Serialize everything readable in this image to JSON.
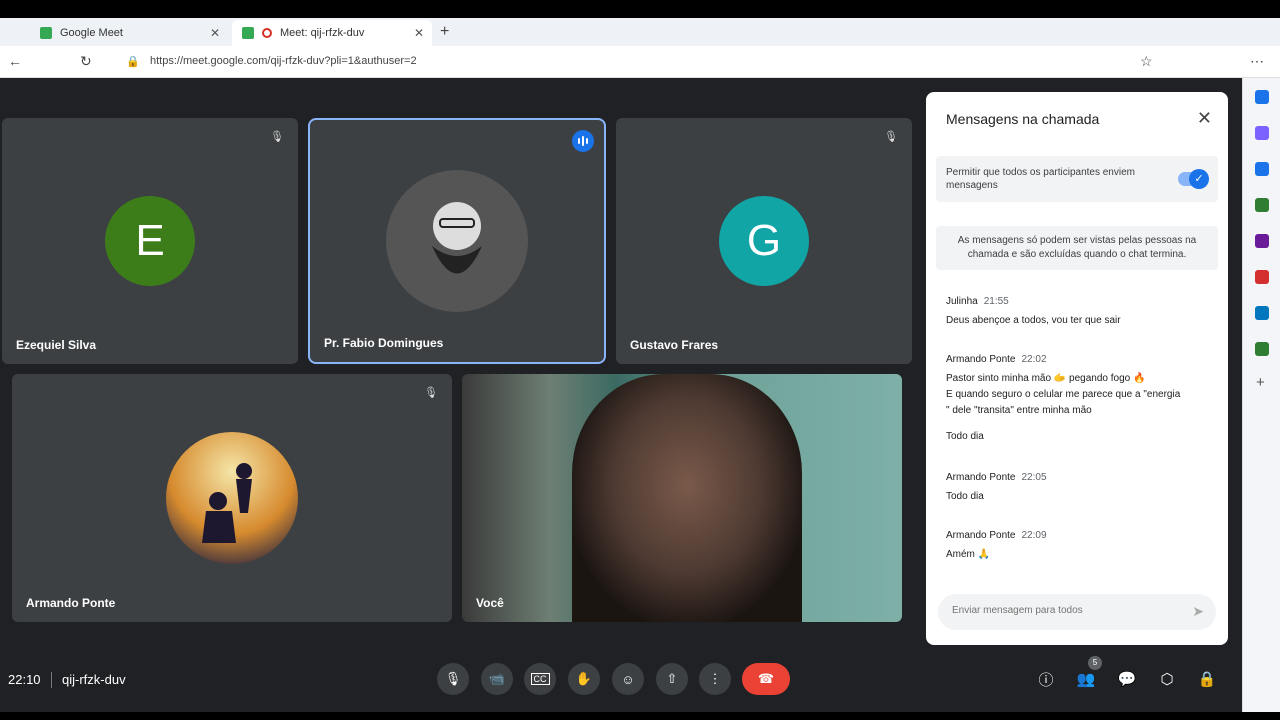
{
  "browser": {
    "tabs": [
      {
        "label": "Google Meet"
      },
      {
        "label": "Meet: qij-rfzk-duv"
      }
    ],
    "url": "https://meet.google.com/qij-rfzk-duv?pli=1&authuser=2"
  },
  "participants": [
    {
      "name": "Ezequiel Silva",
      "initial": "E",
      "color": "#3c7d1a"
    },
    {
      "name": "Pr. Fabio Domingues",
      "initial": ""
    },
    {
      "name": "Gustavo Frares",
      "initial": "G",
      "color": "#12a5a5"
    },
    {
      "name": "Armando Ponte",
      "initial": ""
    },
    {
      "name": "Você",
      "initial": ""
    }
  ],
  "chat": {
    "title": "Mensagens na chamada",
    "allow_text": "Permitir que todos os participantes enviem mensagens",
    "info_text": "As mensagens só podem ser vistas pelas pessoas na chamada e são excluídas quando o chat termina.",
    "messages": [
      {
        "sender": "Julinha",
        "time": "21:55",
        "lines": [
          "Deus abençoe a todos, vou ter que sair"
        ]
      },
      {
        "sender": "Armando Ponte",
        "time": "22:02",
        "lines": [
          "Pastor sinto minha mão 🫱 pegando fogo 🔥",
          "E quando seguro o celular me parece que a \"energia",
          "\" dele \"transita\" entre minha mão",
          "",
          "Todo dia"
        ]
      },
      {
        "sender": "Armando Ponte",
        "time": "22:05",
        "lines": [
          "Todo dia"
        ]
      },
      {
        "sender": "Armando Ponte",
        "time": "22:09",
        "lines": [
          "Amém 🙏"
        ]
      }
    ],
    "composer_placeholder": "Enviar mensagem para todos"
  },
  "meeting": {
    "time": "22:10",
    "code": "qij-rfzk-duv",
    "participant_count": "5"
  }
}
